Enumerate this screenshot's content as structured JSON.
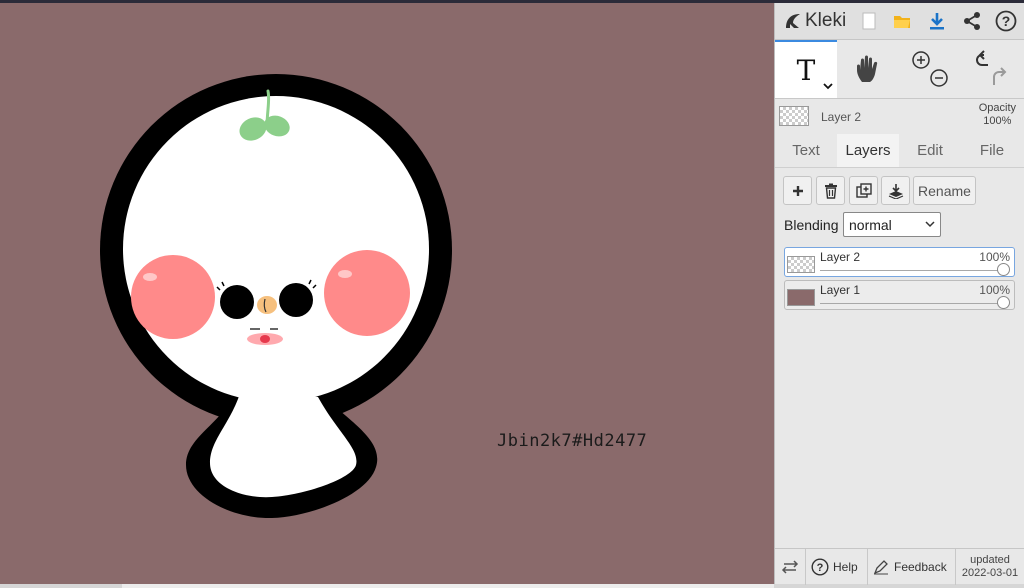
{
  "app": {
    "name": "Kleki"
  },
  "header": {
    "buttons": [
      {
        "name": "new-image-icon"
      },
      {
        "name": "open-folder-icon"
      },
      {
        "name": "download-icon"
      },
      {
        "name": "share-icon"
      },
      {
        "name": "help-icon"
      }
    ]
  },
  "tools": {
    "active_tool_glyph": "T",
    "items": [
      "text-tool-icon",
      "hand-tool-icon",
      "zoom-icon",
      "undo-redo-icon"
    ]
  },
  "current_layer": {
    "name": "Layer 2",
    "opacity_label": "Opacity",
    "opacity_value": "100%"
  },
  "tabs": [
    {
      "label": "Text",
      "active": false
    },
    {
      "label": "Layers",
      "active": true
    },
    {
      "label": "Edit",
      "active": false
    },
    {
      "label": "File",
      "active": false
    }
  ],
  "layer_buttons": {
    "rename_label": "Rename",
    "icons": [
      "add-layer-icon",
      "delete-layer-icon",
      "duplicate-layer-icon",
      "merge-down-icon"
    ]
  },
  "blending": {
    "label": "Blending",
    "value": "normal"
  },
  "layers": [
    {
      "name": "Layer 2",
      "opacity": "100%",
      "opacity_fraction": 1.0,
      "selected": true
    },
    {
      "name": "Layer 1",
      "opacity": "100%",
      "opacity_fraction": 1.0,
      "selected": false
    }
  ],
  "footer": {
    "help_label": "Help",
    "feedback_label": "Feedback",
    "updated_label": "updated",
    "updated_date": "2022-03-01"
  },
  "canvas": {
    "background_color": "#8a6a6b",
    "signature_text": "Jbin2k7#Hd2477"
  },
  "colors": {
    "accent": "#3b8ae0",
    "download": "#1a73c8",
    "folder": "#f2b21a",
    "blush": "#ff8a8a",
    "sprout": "#8ccf8a"
  }
}
